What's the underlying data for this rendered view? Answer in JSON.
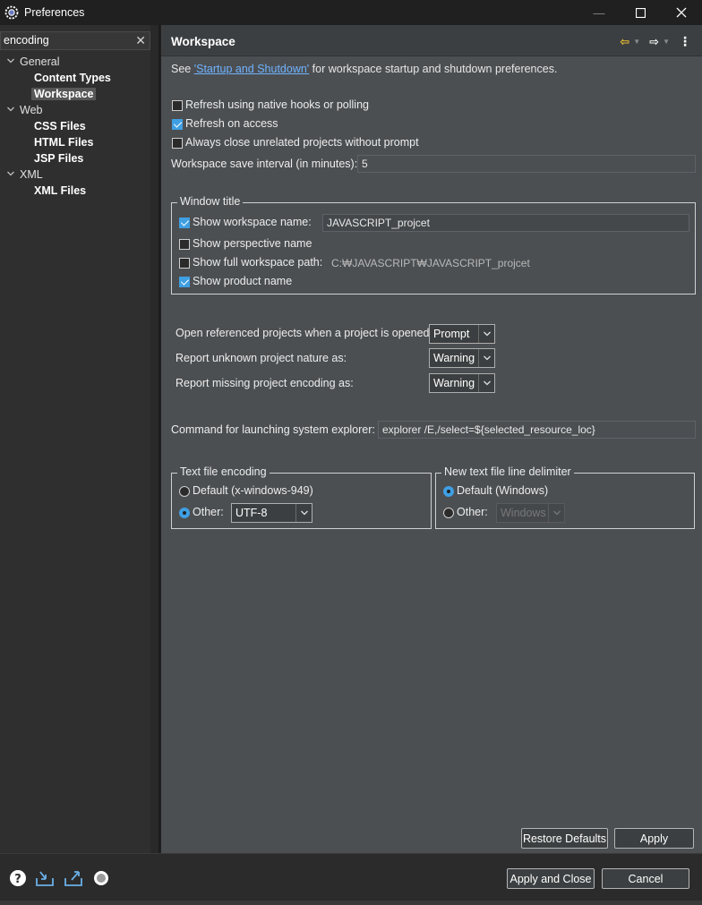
{
  "window": {
    "title": "Preferences",
    "icon": "eclipse-gear-icon"
  },
  "filter": {
    "value": "encoding",
    "clear_icon": "close-icon"
  },
  "tree": {
    "items": [
      {
        "label": "General",
        "level": 0,
        "expanded": true
      },
      {
        "label": "Content Types",
        "level": 1
      },
      {
        "label": "Workspace",
        "level": 1,
        "selected": true
      },
      {
        "label": "Web",
        "level": 0,
        "expanded": true
      },
      {
        "label": "CSS Files",
        "level": 1
      },
      {
        "label": "HTML Files",
        "level": 1
      },
      {
        "label": "JSP Files",
        "level": 1
      },
      {
        "label": "XML",
        "level": 0,
        "expanded": true
      },
      {
        "label": "XML Files",
        "level": 1
      }
    ]
  },
  "page": {
    "title": "Workspace",
    "intro_prefix": "See ",
    "intro_link": "'Startup and Shutdown'",
    "intro_suffix": " for workspace startup and shutdown preferences."
  },
  "options": {
    "refresh_native": {
      "label": "Refresh using native hooks or polling",
      "checked": false
    },
    "refresh_access": {
      "label": "Refresh on access",
      "checked": true
    },
    "always_close": {
      "label": "Always close unrelated projects without prompt",
      "checked": false
    },
    "save_interval_label": "Workspace save interval (in minutes):",
    "save_interval_value": "5"
  },
  "window_title_group": {
    "title": "Window title",
    "show_workspace_name": {
      "label": "Show workspace name:",
      "checked": true,
      "value": "JAVASCRIPT_projcet"
    },
    "show_perspective_name": {
      "label": "Show perspective name",
      "checked": false
    },
    "show_full_path": {
      "label": "Show full workspace path:",
      "checked": false,
      "value": "C:₩JAVASCRIPT₩JAVASCRIPT_projcet"
    },
    "show_product_name": {
      "label": "Show product name",
      "checked": true
    }
  },
  "project_settings": {
    "open_referenced": {
      "label": "Open referenced projects when a project is opened:",
      "value": "Prompt"
    },
    "unknown_nature": {
      "label": "Report unknown project nature as:",
      "value": "Warning"
    },
    "missing_encoding": {
      "label": "Report missing project encoding as:",
      "value": "Warning"
    }
  },
  "explorer": {
    "label": "Command for launching system explorer:",
    "value": "explorer /E,/select=${selected_resource_loc}"
  },
  "text_encoding": {
    "title": "Text file encoding",
    "default_label": "Default (x-windows-949)",
    "default_selected": false,
    "other_label": "Other:",
    "other_selected": true,
    "other_value": "UTF-8"
  },
  "line_delimiter": {
    "title": "New text file line delimiter",
    "default_label": "Default (Windows)",
    "default_selected": true,
    "other_label": "Other:",
    "other_selected": false,
    "other_value": "Windows"
  },
  "buttons": {
    "restore_defaults": "Restore Defaults",
    "apply": "Apply",
    "apply_and_close": "Apply and Close",
    "cancel": "Cancel"
  },
  "bottom_icons": [
    "help-icon",
    "import-icon",
    "export-icon",
    "record-icon"
  ],
  "colors": {
    "accent": "#3f9fe3",
    "link": "#6fb3ff",
    "nav_back": "#f1c232",
    "background": "#4c4f52"
  }
}
